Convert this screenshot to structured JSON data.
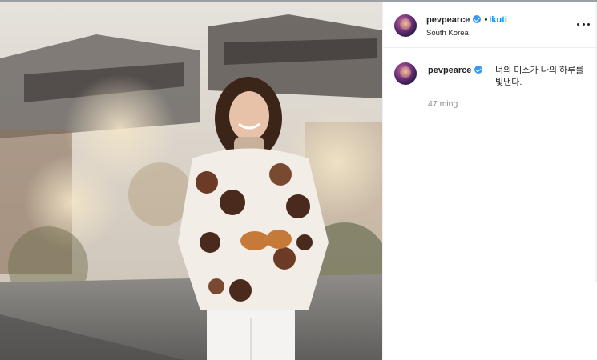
{
  "post": {
    "username": "pevpearce",
    "follow_label": "Ikuti",
    "location": "South Korea",
    "caption": "너의 미소가 나의 하루를 빛낸다.",
    "time_ago": "47 ming"
  },
  "icons": {
    "verified": "verified-badge-icon",
    "more": "more-options-icon"
  },
  "colors": {
    "verified_blue": "#3897f0",
    "follow_blue": "#0095f6",
    "muted_text": "#8e8e8e"
  }
}
